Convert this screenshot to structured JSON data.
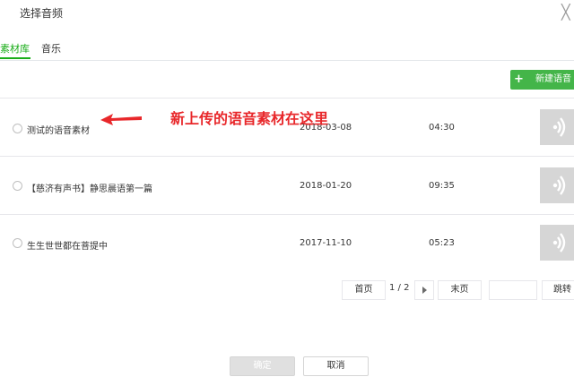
{
  "dialog": {
    "title": "选择音频"
  },
  "tabs": [
    {
      "label": "素材库",
      "active": true
    },
    {
      "label": "音乐",
      "active": false
    }
  ],
  "toolbar": {
    "new_voice_label": "新建语音"
  },
  "annotation": {
    "text": "新上传的语音素材在这里",
    "color": "#e8272a"
  },
  "items": [
    {
      "name": "测试的语音素材",
      "date": "2018-03-08",
      "duration": "04:30"
    },
    {
      "name": "【慈济有声书】静思晨语第一篇",
      "date": "2018-01-20",
      "duration": "09:35"
    },
    {
      "name": "生生世世都在菩提中",
      "date": "2017-11-10",
      "duration": "05:23"
    }
  ],
  "pagination": {
    "first_label": "首页",
    "page_indicator": "1 / 2",
    "last_label": "末页",
    "jump_value": "",
    "jump_label": "跳转"
  },
  "footer": {
    "confirm_label": "确定",
    "cancel_label": "取消"
  },
  "colors": {
    "accent": "#1aad19",
    "button_green": "#44b549",
    "voice_box": "#d6d6d6"
  }
}
